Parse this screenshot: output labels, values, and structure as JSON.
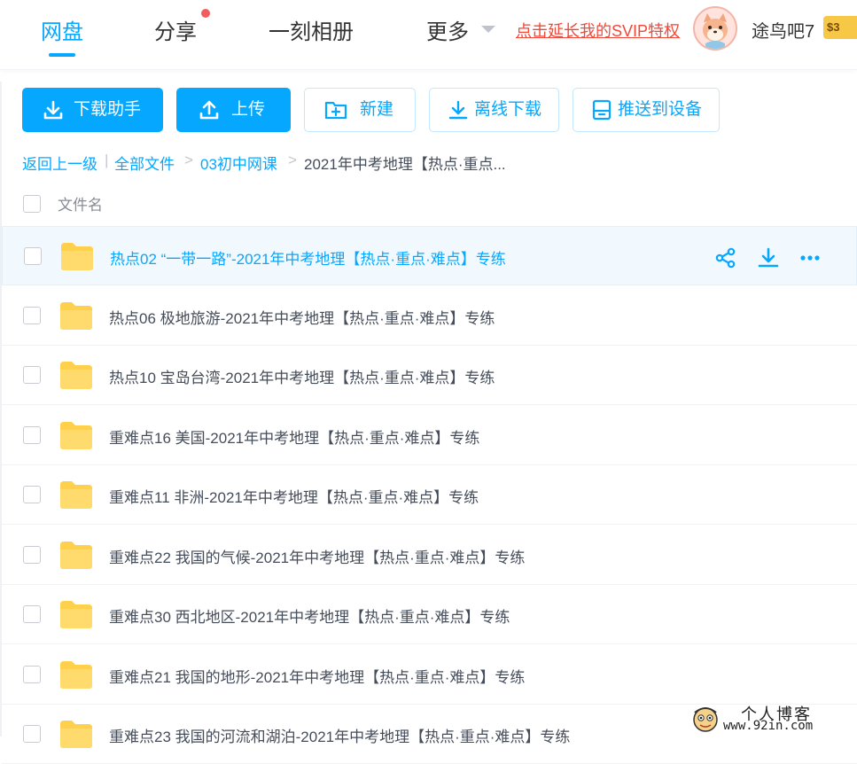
{
  "nav": {
    "tabs": [
      {
        "label": "网盘",
        "active": true
      },
      {
        "label": "分享",
        "has_notification": true
      },
      {
        "label": "一刻相册"
      },
      {
        "label": "更多"
      }
    ],
    "svip_promo": "点击延长我的SVIP特权",
    "user": {
      "name": "途鸟吧7",
      "badge": "$3"
    }
  },
  "toolbar": {
    "download_helper": "下载助手",
    "upload": "上传",
    "new_folder": "新建",
    "offline_download": "离线下载",
    "push_to_device": "推送到设备"
  },
  "breadcrumb": {
    "back": "返回上一级",
    "divider": "|",
    "items": [
      "全部文件",
      "03初中网课",
      "2021年中考地理【热点·重点..."
    ],
    "separator": ">"
  },
  "list": {
    "header": "文件名",
    "files": [
      "热点02 “一带一路”-2021年中考地理【热点·重点·难点】专练",
      "热点06 极地旅游-2021年中考地理【热点·重点·难点】专练",
      "热点10 宝岛台湾-2021年中考地理【热点·重点·难点】专练",
      "重难点16 美国-2021年中考地理【热点·重点·难点】专练",
      "重难点11 非洲-2021年中考地理【热点·重点·难点】专练",
      "重难点22 我国的气候-2021年中考地理【热点·重点·难点】专练",
      "重难点30 西北地区-2021年中考地理【热点·重点·难点】专练",
      "重难点21 我国的地形-2021年中考地理【热点·重点·难点】专练",
      "重难点23 我国的河流和湖泊-2021年中考地理【热点·重点·难点】专练"
    ],
    "hovered_index": 0
  },
  "watermark": {
    "title": "个人博客",
    "url": "www.92in.com"
  },
  "colors": {
    "accent": "#06a7ff",
    "promo": "#f0493a",
    "folder": "#ffd04b"
  }
}
